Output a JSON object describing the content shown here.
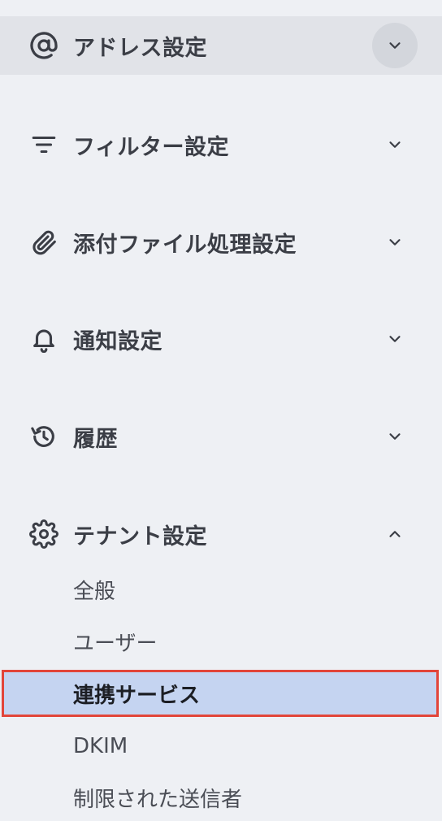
{
  "sections": [
    {
      "label": "アドレス設定",
      "icon": "at-icon",
      "expanded": false
    },
    {
      "label": "フィルター設定",
      "icon": "filter-icon",
      "expanded": false
    },
    {
      "label": "添付ファイル処理設定",
      "icon": "paperclip-icon",
      "expanded": false
    },
    {
      "label": "通知設定",
      "icon": "bell-icon",
      "expanded": false
    },
    {
      "label": "履歴",
      "icon": "history-icon",
      "expanded": false
    },
    {
      "label": "テナント設定",
      "icon": "gear-icon",
      "expanded": true
    }
  ],
  "tenant_sub_items": [
    {
      "label": "全般"
    },
    {
      "label": "ユーザー"
    },
    {
      "label": "連携サービス",
      "selected": true
    },
    {
      "label": "DKIM"
    },
    {
      "label": "制限された送信者"
    }
  ],
  "colors": {
    "background": "#eef0f4",
    "active_section_bg": "#e1e3e8",
    "selected_item_bg": "#c5d4f1",
    "selection_outline": "#e2453a",
    "text": "#3b3e46"
  }
}
